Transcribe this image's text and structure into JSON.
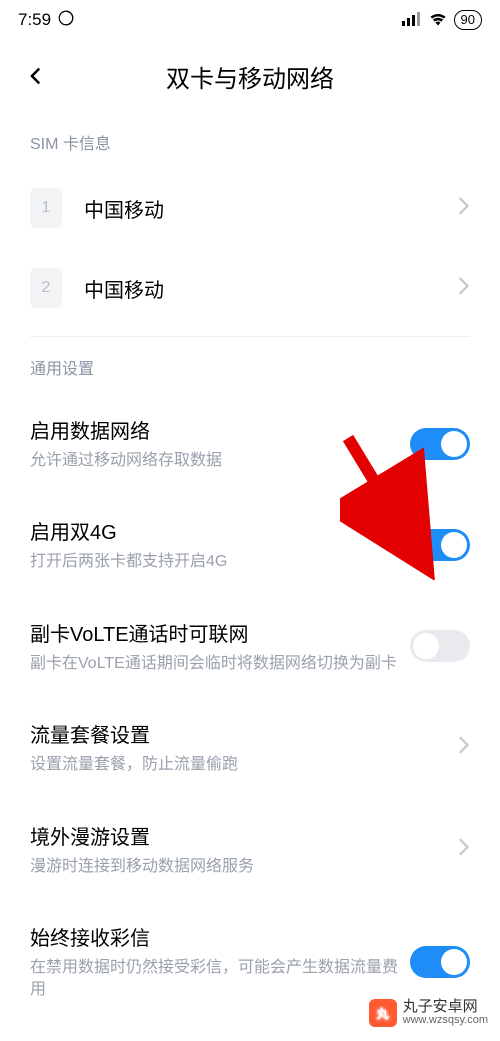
{
  "status": {
    "time": "7:59",
    "battery": "90"
  },
  "header": {
    "title": "双卡与移动网络"
  },
  "sim_section": {
    "label": "SIM 卡信息",
    "cards": [
      {
        "slot": "1",
        "name": "中国移动"
      },
      {
        "slot": "2",
        "name": "中国移动"
      }
    ]
  },
  "general_section": {
    "label": "通用设置",
    "items": [
      {
        "title": "启用数据网络",
        "desc": "允许通过移动网络存取数据",
        "type": "toggle",
        "on": true
      },
      {
        "title": "启用双4G",
        "desc": "打开后两张卡都支持开启4G",
        "type": "toggle",
        "on": true
      },
      {
        "title": "副卡VoLTE通话时可联网",
        "desc": "副卡在VoLTE通话期间会临时将数据网络切换为副卡",
        "type": "toggle",
        "on": false
      },
      {
        "title": "流量套餐设置",
        "desc": "设置流量套餐，防止流量偷跑",
        "type": "nav"
      },
      {
        "title": "境外漫游设置",
        "desc": "漫游时连接到移动数据网络服务",
        "type": "nav"
      },
      {
        "title": "始终接收彩信",
        "desc": "在禁用数据时仍然接受彩信，可能会产生数据流量费用",
        "type": "toggle",
        "on": true
      }
    ]
  },
  "watermark": {
    "name": "丸子安卓网",
    "url": "www.wzsqsy.com"
  }
}
